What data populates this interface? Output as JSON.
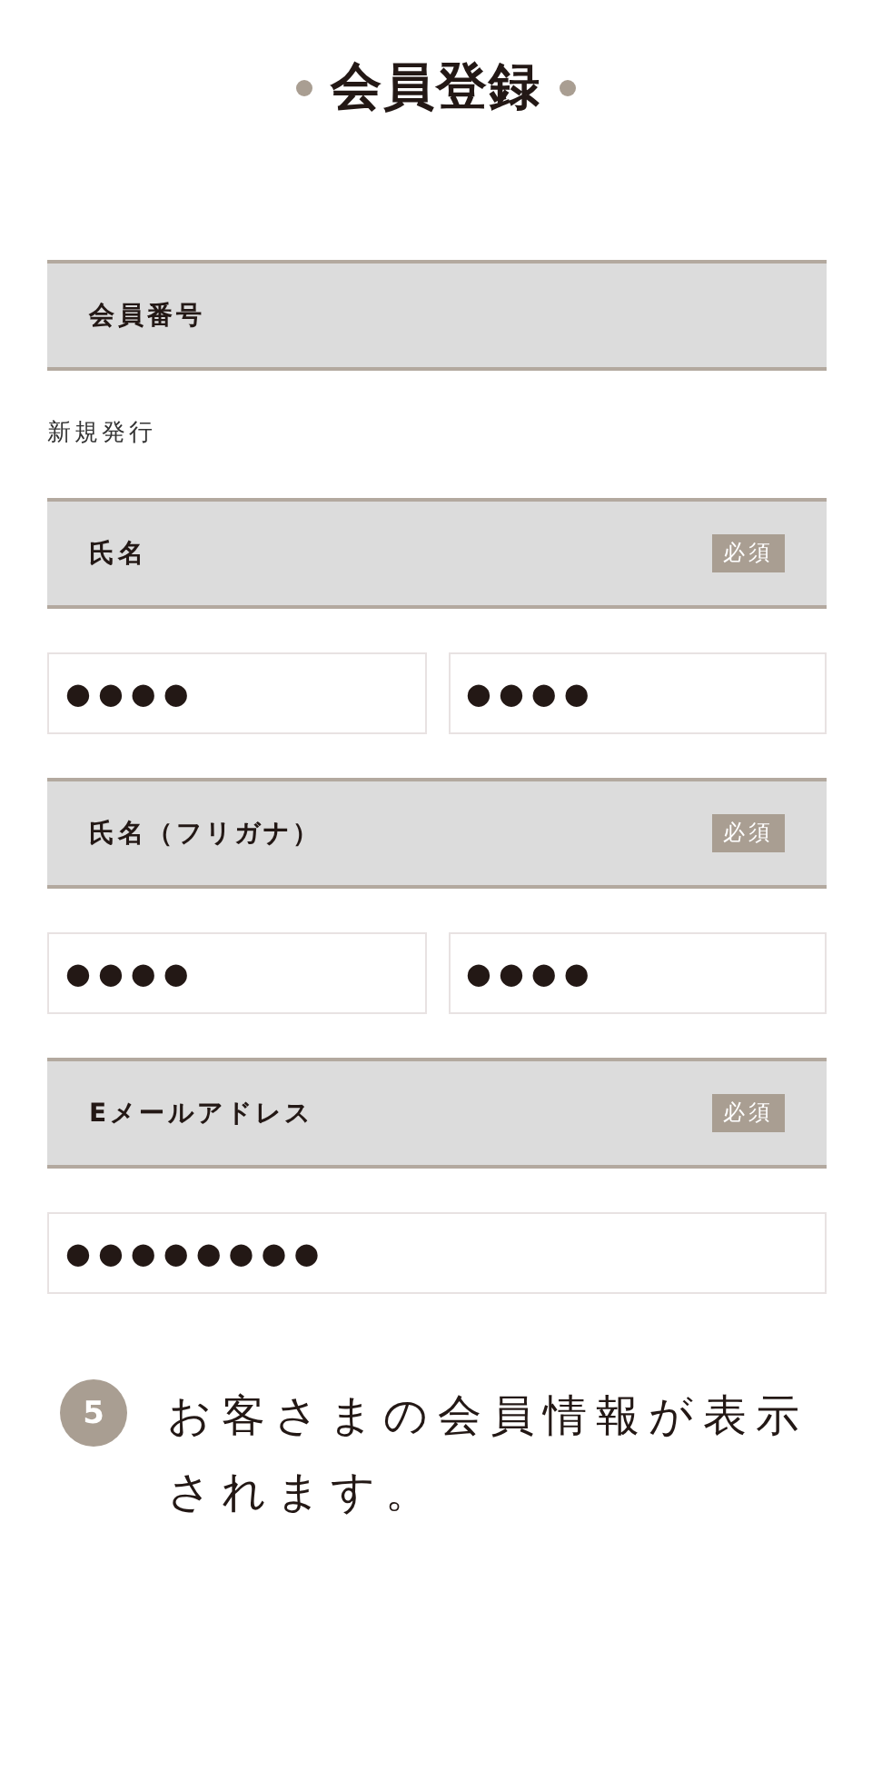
{
  "title": "会員登録",
  "sections": [
    {
      "label": "会員番号",
      "note": "新規発行"
    },
    {
      "label": "氏名",
      "badge": "必須",
      "fields": [
        {
          "value": "●●●●"
        },
        {
          "value": "●●●●"
        }
      ]
    },
    {
      "label": "氏名（フリガナ）",
      "badge": "必須",
      "fields": [
        {
          "value": "●●●●"
        },
        {
          "value": "●●●●"
        }
      ]
    },
    {
      "label": "Eメールアドレス",
      "badge": "必須",
      "fields": [
        {
          "value": "●●●●●●●●"
        }
      ]
    }
  ],
  "step": {
    "number": "5",
    "text": "お客さまの会員情報が表示されます。"
  }
}
